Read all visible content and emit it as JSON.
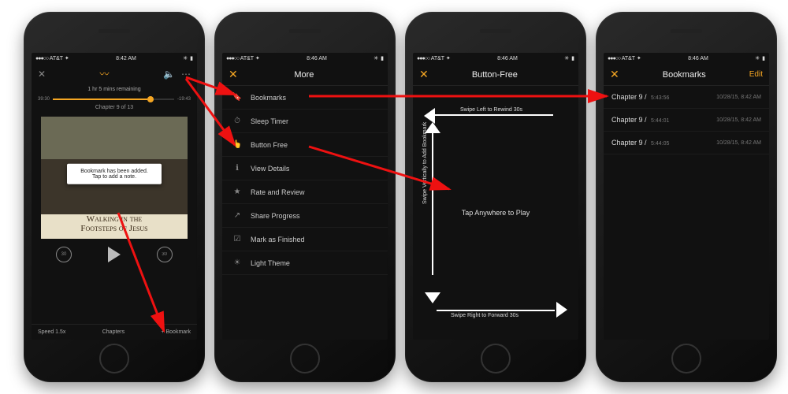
{
  "statusbar": {
    "carrier": "AT&T",
    "signal": "●●●○○",
    "wifi": "✦",
    "time1": "8:42 AM",
    "time2": "8:46 AM",
    "time3": "8:46 AM",
    "time4": "8:46 AM",
    "bt": "✳",
    "battery": "▮"
  },
  "player": {
    "remaining": "1 hr 5 mins remaining",
    "elapsed": "39:30",
    "left": "-19:43",
    "chapter": "Chapter 9 of 13",
    "book_title_line1": "Walking in the",
    "book_title_line2": "Footsteps of Jesus",
    "toast_line1": "Bookmark has been added.",
    "toast_line2": "Tap to add a note.",
    "speed": "Speed 1.5x",
    "chapters": "Chapters",
    "bookmark": "+ Bookmark",
    "back30": "30"
  },
  "more": {
    "title": "More",
    "items": [
      {
        "icon": "🔖",
        "label": "Bookmarks"
      },
      {
        "icon": "⏱",
        "label": "Sleep Timer"
      },
      {
        "icon": "👆",
        "label": "Button Free"
      },
      {
        "icon": "ℹ",
        "label": "View Details"
      },
      {
        "icon": "★",
        "label": "Rate and Review"
      },
      {
        "icon": "↗",
        "label": "Share Progress"
      },
      {
        "icon": "☑",
        "label": "Mark as Finished"
      },
      {
        "icon": "☀",
        "label": "Light Theme"
      }
    ]
  },
  "button_free": {
    "title": "Button-Free",
    "swipe_left": "Swipe Left to Rewind 30s",
    "swipe_right": "Swipe Right to Forward 30s",
    "swipe_vert": "Swipe Vertically to Add Bookmark",
    "tap": "Tap Anywhere to Play"
  },
  "bookmarks": {
    "title": "Bookmarks",
    "edit": "Edit",
    "rows": [
      {
        "chapter": "Chapter 9",
        "pos": "5:43:56",
        "date": "10/28/15, 8:42 AM"
      },
      {
        "chapter": "Chapter 9",
        "pos": "5:44:01",
        "date": "10/28/15, 8:42 AM"
      },
      {
        "chapter": "Chapter 9",
        "pos": "5:44:05",
        "date": "10/28/15, 8:42 AM"
      }
    ]
  },
  "colors": {
    "accent": "#f5a623"
  }
}
